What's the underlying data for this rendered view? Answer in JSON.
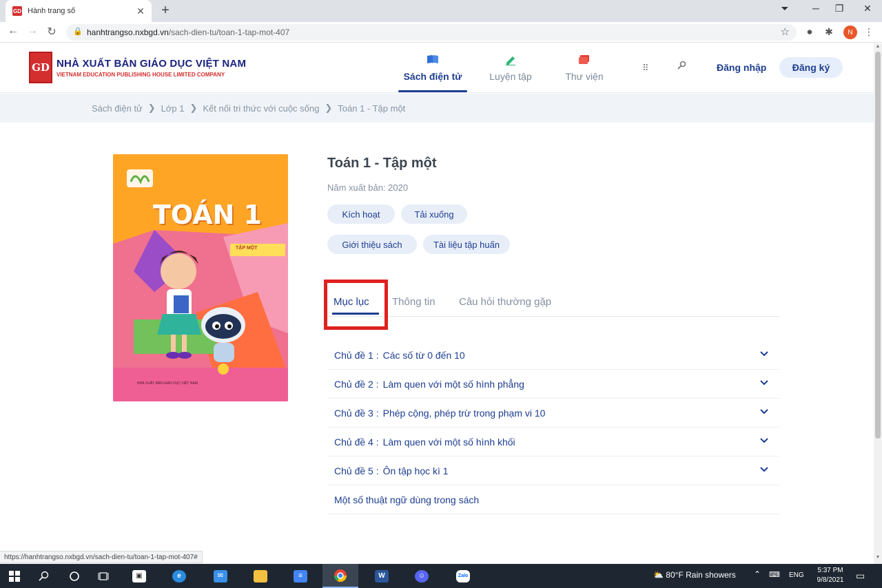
{
  "browser": {
    "tab_title": "Hành trang số",
    "tab_favicon_text": "GD",
    "url_host": "hanhtrangso.nxbgd.vn",
    "url_path": "/sach-dien-tu/toan-1-tap-mot-407",
    "profile_initial": "N",
    "status_url": "https://hanhtrangso.nxbgd.vn/sach-dien-tu/toan-1-tap-mot-407#"
  },
  "site": {
    "logo_mark": "GD",
    "logo_line1": "NHÀ XUẤT BẢN GIÁO DỤC VIỆT NAM",
    "logo_line2": "VIETNAM EDUCATION PUBLISHING HOUSE LIMITED COMPANY",
    "nav": [
      {
        "label": "Sách điện tử",
        "icon": "book-icon",
        "color": "#2f6fd6"
      },
      {
        "label": "Luyện tập",
        "icon": "pencil-icon",
        "color": "#2bb673"
      },
      {
        "label": "Thư viện",
        "icon": "library-icon",
        "color": "#e0433b"
      }
    ],
    "login": "Đăng nhập",
    "register": "Đăng ký"
  },
  "breadcrumb": [
    "Sách điện tử",
    "Lớp 1",
    "Kết nối tri thức với cuộc sống",
    "Toán 1 - Tập một"
  ],
  "book": {
    "cover_title": "TOÁN 1",
    "cover_sub": "TẬP MỘT",
    "cover_footer": "NHÀ XUẤT BẢN GIÁO DỤC VIỆT NAM",
    "title": "Toán 1 - Tập một",
    "year": "Năm xuất bản: 2020",
    "actions": [
      "Kích hoạt",
      "Tải xuống",
      "Giới thiệu sách",
      "Tài liệu tập huấn"
    ]
  },
  "tabs": [
    "Mục lục",
    "Thông tin",
    "Câu hỏi thường gặp"
  ],
  "toc": [
    {
      "num": "Chủ đề 1 :",
      "title": "Các số từ 0 đến 10",
      "expandable": true
    },
    {
      "num": "Chủ đề 2 :",
      "title": "Làm quen với một số hình phẳng",
      "expandable": true
    },
    {
      "num": "Chủ đề 3 :",
      "title": "Phép cộng, phép trừ trong phạm vi 10",
      "expandable": true
    },
    {
      "num": "Chủ đề 4 :",
      "title": "Làm quen với một số hình khối",
      "expandable": true
    },
    {
      "num": "Chủ đề 5 :",
      "title": "Ôn tập học kì 1",
      "expandable": true
    },
    {
      "num": "",
      "title": "Một số thuật ngữ dùng trong sách",
      "expandable": false
    }
  ],
  "taskbar": {
    "weather": "80°F  Rain showers",
    "lang": "ENG",
    "time": "5:37 PM",
    "date": "9/8/2021"
  }
}
